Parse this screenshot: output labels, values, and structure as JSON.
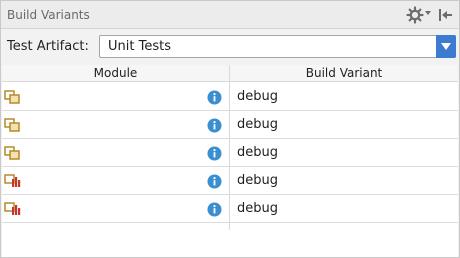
{
  "panel": {
    "title": "Build Variants",
    "settings_icon": "gear-icon",
    "hide_icon": "hide-panel-icon"
  },
  "test_artifact": {
    "label": "Test Artifact:",
    "selected": "Unit Tests"
  },
  "table": {
    "headers": {
      "module": "Module",
      "build_variant": "Build Variant"
    },
    "rows": [
      {
        "module_icon": "app-module-icon",
        "variant": "debug"
      },
      {
        "module_icon": "app-module-icon",
        "variant": "debug"
      },
      {
        "module_icon": "app-module-icon",
        "variant": "debug"
      },
      {
        "module_icon": "library-module-icon",
        "variant": "debug"
      },
      {
        "module_icon": "library-module-icon",
        "variant": "debug"
      }
    ]
  },
  "colors": {
    "accent": "#3d7bd0",
    "info_icon": "#3a8fd0",
    "app_module": "#b58a2a",
    "library_module": "#c0392b"
  }
}
